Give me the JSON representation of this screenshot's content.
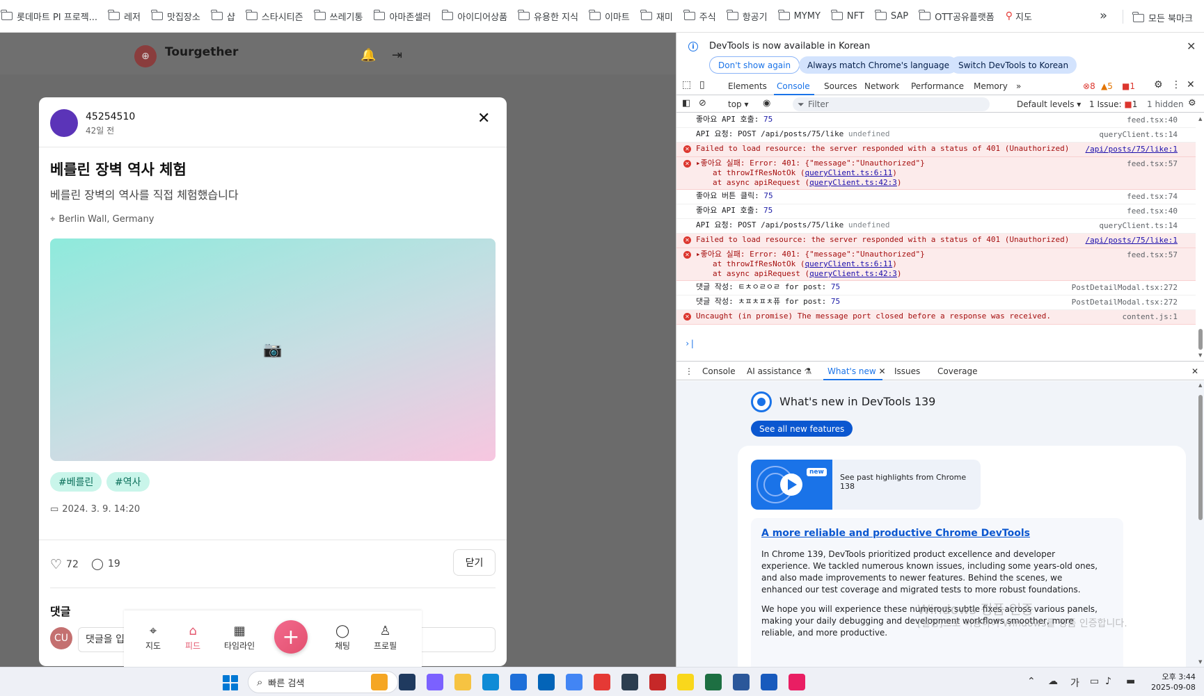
{
  "bookmarks": {
    "items": [
      "롯데마트 PI 프로젝...",
      "레저",
      "맛집장소",
      "샵",
      "스타시티즌",
      "쓰레기통",
      "아마존셀러",
      "아이디어상품",
      "유용한 지식",
      "이마트",
      "재미",
      "주식",
      "항공기",
      "MYMY",
      "NFT",
      "SAP",
      "OTT공유플랫폼"
    ],
    "map": "지도",
    "all": "모든 북마크"
  },
  "app": {
    "title": "Tourgether"
  },
  "post": {
    "user": "45254510",
    "time": "42일 전",
    "title": "베를린 장벽 역사 체험",
    "description": "베를린 장벽의 역사를 직접 체험했습니다",
    "location": "Berlin Wall, Germany",
    "image_icon": "📷",
    "tags": [
      "#베를린",
      "#역사"
    ],
    "date": "2024. 3. 9. 14:20",
    "likes": "72",
    "comments": "19",
    "close_label": "닫기",
    "comments_title": "댓글",
    "commenter_initials": "CU",
    "comment_placeholder": "댓글을 입력하세요"
  },
  "bottom_nav": {
    "items": [
      "지도",
      "피드",
      "타임라인",
      "채팅",
      "프로필"
    ],
    "add": "+"
  },
  "devtools": {
    "info": {
      "message": "DevTools is now available in Korean",
      "btn_dont_show": "Don't show again",
      "btn_match": "Always match Chrome's language",
      "btn_switch": "Switch DevTools to Korean"
    },
    "tabs": [
      "Elements",
      "Console",
      "Sources",
      "Network",
      "Performance",
      "Memory"
    ],
    "counts": {
      "errors": "8",
      "warnings": "5",
      "issues": "1"
    },
    "toolbar": {
      "context": "top ▾",
      "filter_placeholder": "Filter",
      "levels": "Default levels ▾",
      "issues": "1 Issue:",
      "issues_count": "1",
      "hidden": "1 hidden"
    },
    "console": [
      {
        "type": "log",
        "text": "좋아요 API 호출:",
        "num": "75",
        "src": "feed.tsx:40"
      },
      {
        "type": "log",
        "text": "API 요청: POST /api/posts/75/like",
        "undef": "undefined",
        "src": "queryClient.ts:14"
      },
      {
        "type": "err",
        "text": "Failed to load resource: the server responded with a status of 401 (Unauthorized)",
        "src": "/api/posts/75/like:1",
        "link": true
      },
      {
        "type": "err",
        "text": "▸좋아요 실패: Error: 401: {\"message\":\"Unauthorized\"}",
        "src": "feed.tsx:57",
        "sub1a": "at throwIfResNotOk (",
        "sub1b": "queryClient.ts:6:11",
        "sub1c": ")",
        "sub2a": "at async apiRequest (",
        "sub2b": "queryClient.ts:42:3",
        "sub2c": ")"
      },
      {
        "type": "log",
        "text": "좋아요 버튼 클릭:",
        "num": "75",
        "src": "feed.tsx:74"
      },
      {
        "type": "log",
        "text": "좋아요 API 호출:",
        "num": "75",
        "src": "feed.tsx:40"
      },
      {
        "type": "log",
        "text": "API 요청: POST /api/posts/75/like",
        "undef": "undefined",
        "src": "queryClient.ts:14"
      },
      {
        "type": "err",
        "text": "Failed to load resource: the server responded with a status of 401 (Unauthorized)",
        "src": "/api/posts/75/like:1",
        "link": true
      },
      {
        "type": "err",
        "text": "▸좋아요 실패: Error: 401: {\"message\":\"Unauthorized\"}",
        "src": "feed.tsx:57",
        "sub1a": "at throwIfResNotOk (",
        "sub1b": "queryClient.ts:6:11",
        "sub1c": ")",
        "sub2a": "at async apiRequest (",
        "sub2b": "queryClient.ts:42:3",
        "sub2c": ")"
      },
      {
        "type": "log",
        "text": "댓글 작성: ㅌㅊㅇㄹㅇㄹ for post:",
        "num": "75",
        "src": "PostDetailModal.tsx:272"
      },
      {
        "type": "log",
        "text": "댓글 작성: ㅊㅍㅊㅍㅊ퓨 for post:",
        "num": "75",
        "src": "PostDetailModal.tsx:272"
      },
      {
        "type": "err",
        "text": "Uncaught (in promise) The message port closed before a response was received.",
        "src": "content.js:1"
      }
    ],
    "prompt": "›",
    "drawer_tabs": [
      "Console",
      "AI assistance",
      "What's new",
      "Issues",
      "Coverage"
    ],
    "whats_new": {
      "title": "What's new in DevTools 139",
      "button": "See all new features",
      "highlight_badge": "new",
      "highlight": "See past highlights from Chrome 138",
      "article_title": "A more reliable and productive Chrome DevTools",
      "p1": "In Chrome 139, DevTools prioritized product excellence and developer experience. We tackled numerous known issues, including some years-old ones, and also made improvements to newer features. Behind the scenes, we enhanced our test coverage and migrated tests to more robust foundations.",
      "p2": "We hope you will experience these numerous subtle fixes across various panels, making your daily debugging and development workflows smoother, more reliable, and more productive."
    },
    "watermark1": "Windows 정품 인증",
    "watermark2": "[설정]으로 이동하여 Windows를 정품 인증합니다."
  },
  "taskbar": {
    "search": "빠른 검색",
    "ime": "가",
    "time": "오후 3:44",
    "date": "2025-09-08"
  }
}
